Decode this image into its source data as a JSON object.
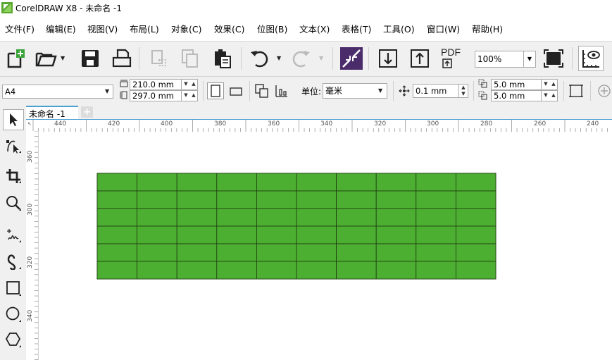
{
  "window": {
    "title": "CorelDRAW X8 - 未命名 -1"
  },
  "menu": [
    {
      "label": "文件(F)"
    },
    {
      "label": "编辑(E)"
    },
    {
      "label": "视图(V)"
    },
    {
      "label": "布局(L)"
    },
    {
      "label": "对象(C)"
    },
    {
      "label": "效果(C)"
    },
    {
      "label": "位图(B)"
    },
    {
      "label": "文本(X)"
    },
    {
      "label": "表格(T)"
    },
    {
      "label": "工具(O)"
    },
    {
      "label": "窗口(W)"
    },
    {
      "label": "帮助(H)"
    }
  ],
  "toolbar": {
    "icons": [
      "new-icon",
      "open-icon",
      "save-icon",
      "print-icon",
      "cut-icon",
      "copy-icon",
      "paste-icon",
      "undo-icon",
      "redo-icon",
      "import-icon",
      "export-icon",
      "publish-pdf-icon",
      "full-screen-icon",
      "options-icon"
    ],
    "pdf_label": "PDF",
    "zoom_value": "100%"
  },
  "propbar": {
    "page_size": "A4",
    "width": "210.0 mm",
    "height": "297.0 mm",
    "units_label": "单位:",
    "units_value": "毫米",
    "nudge": "0.1 mm",
    "dup_x": "5.0 mm",
    "dup_y": "5.0 mm"
  },
  "document": {
    "tab_label": "未命名 -1",
    "add_tab": "+"
  },
  "ruler": {
    "h_labels": [
      "440",
      "420",
      "400",
      "380",
      "360",
      "340",
      "320",
      "300",
      "280",
      "260",
      "240"
    ],
    "v_labels": [
      "300",
      "320",
      "340",
      "360"
    ]
  },
  "table": {
    "rows": 6,
    "cols": 10,
    "fill_color": "#4caf32",
    "line_color": "#1e3a10"
  },
  "colors": {
    "chrome": "#f0f0f0",
    "accent": "#4aa0d0",
    "logo": "#6cbf3a"
  }
}
